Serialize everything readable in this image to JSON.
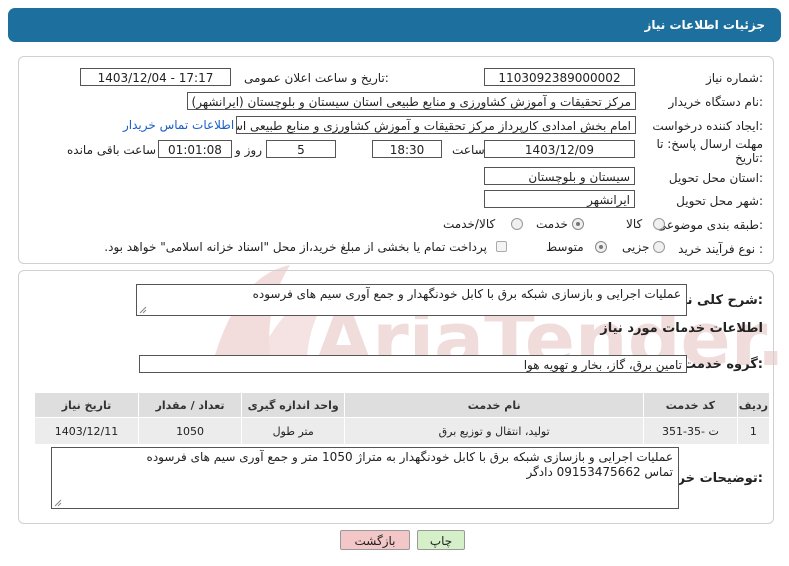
{
  "header": {
    "title": "جزئیات اطلاعات نیاز"
  },
  "form": {
    "need_number": {
      "label": "شماره نیاز:",
      "value": "1103092389000002"
    },
    "announce_datetime": {
      "label": "تاریخ و ساعت اعلان عمومی:",
      "value": "1403/12/04 - 17:17"
    },
    "buyer_org": {
      "label": "نام دستگاه خریدار:",
      "value": "مرکز تحقیقات و آموزش کشاورزی و منابع طبیعی استان سیستان و بلوچستان (ایرانشهر)"
    },
    "requester": {
      "label": "ایجاد کننده درخواست:",
      "value": "امام بخش امدادی کارپرداز مرکز تحقیقات و آموزش کشاورزی و منابع طبیعی استان",
      "contact_link": "اطلاعات تماس خریدار"
    },
    "deadline": {
      "label_line1": "مهلت ارسال پاسخ: تا",
      "label_line2": "تاریخ:",
      "date": "1403/12/09",
      "time_label": "ساعت",
      "time": "18:30",
      "days": "5",
      "days_label": "روز و",
      "remaining": "01:01:08",
      "remaining_label": "ساعت باقی مانده"
    },
    "province": {
      "label": "استان محل تحویل:",
      "value": "سیستان و بلوچستان"
    },
    "city": {
      "label": "شهر محل تحویل:",
      "value": "ایرانشهر"
    },
    "category": {
      "label": "طبقه بندی موضوعی:",
      "options": [
        "کالا",
        "خدمت",
        "کالا/خدمت"
      ],
      "selected": "خدمت"
    },
    "process_type": {
      "label": "نوع فرآیند خرید :",
      "options": [
        "جزیی",
        "متوسط"
      ],
      "selected": "متوسط",
      "payment_note": "پرداخت تمام یا بخشی از مبلغ خرید،از محل \"اسناد خزانه اسلامی\" خواهد بود."
    }
  },
  "summary": {
    "label": "شرح کلی نیاز:",
    "value": "عملیات اجرایی و بازسازی شبکه برق با کابل خودنگهدار و جمع آوری سیم های فرسوده"
  },
  "services": {
    "title": "اطلاعات خدمات مورد نیاز",
    "group_label": "گروه خدمت:",
    "group_value": "تامین برق، گاز، بخار و تهویه هوا",
    "table": {
      "headers": [
        "ردیف",
        "کد خدمت",
        "نام خدمت",
        "واحد اندازه گیری",
        "تعداد / مقدار",
        "تاریخ نیاز"
      ],
      "rows": [
        [
          "1",
          "ت -35-351",
          "تولید، انتقال و توزیع برق",
          "متر طول",
          "1050",
          "1403/12/11"
        ]
      ]
    }
  },
  "buyer_notes": {
    "label": "توضیحات خریدار:",
    "line1": "عملیات اجرایی و بازسازی شبکه برق با کابل خودنگهدار به متراژ 1050 متر و جمع آوری سیم های فرسوده",
    "line2": "تماس 09153475662 دادگر"
  },
  "buttons": {
    "print": "چاپ",
    "back": "بازگشت"
  },
  "watermark": {
    "text": "AriaTender.neT"
  },
  "colors": {
    "header_bg": "#1d6f9e",
    "link": "#1a5ec9",
    "print_btn": "#d5f0c8",
    "back_btn": "#f3c7c7",
    "watermark": "#f0d6d6"
  }
}
